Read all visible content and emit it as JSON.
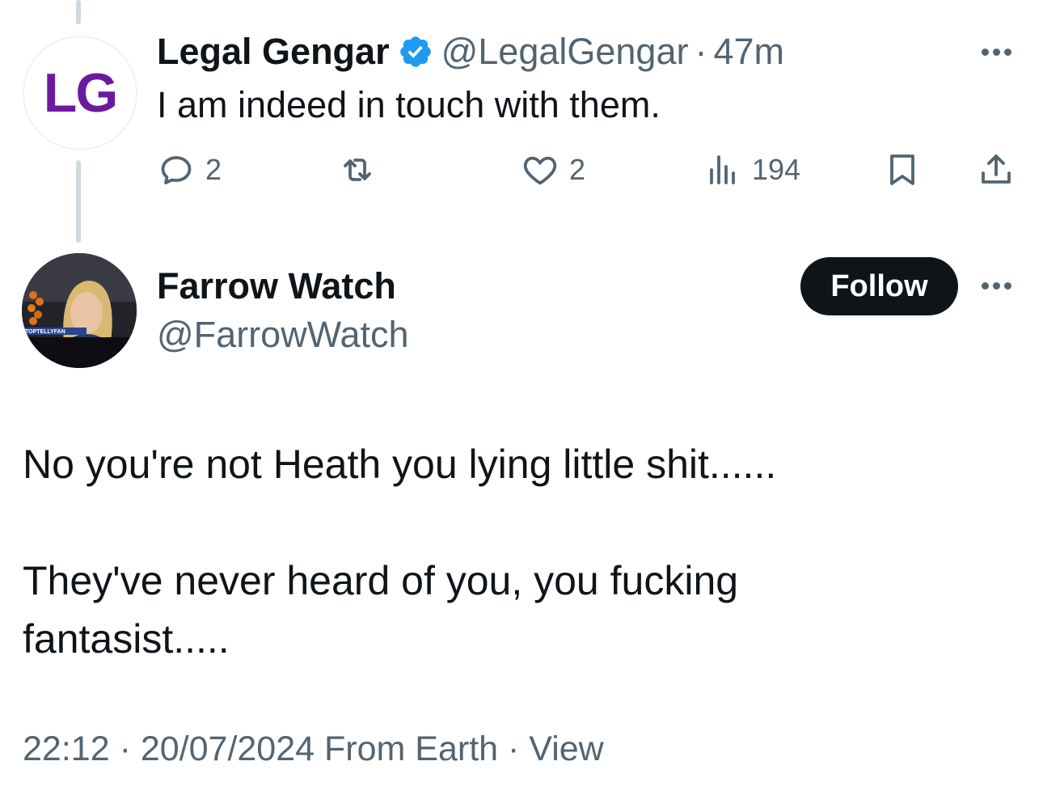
{
  "tweet1": {
    "avatar_text": "LG",
    "name": "Legal Gengar",
    "verified_icon": "verified-badge-icon",
    "handle": "@LegalGengar",
    "separator": "·",
    "time": "47m",
    "text": "I am indeed in touch with them.",
    "actions": {
      "reply_count": "2",
      "retweet_count": "",
      "like_count": "2",
      "views_count": "194"
    }
  },
  "tweet2": {
    "name": "Farrow Watch",
    "handle": "@FarrowWatch",
    "follow_label": "Follow",
    "avatar_caption": "TOPTELLYFAN",
    "paragraphs": [
      "No you're not Heath you lying little shit......",
      "They've never heard of you, you fucking fantasist....."
    ],
    "meta": {
      "time": "22:12",
      "date": "20/07/2024",
      "source": "From Earth",
      "view_label": "View",
      "separator": "·"
    }
  },
  "colors": {
    "text_primary": "#0f1419",
    "text_secondary": "#536471",
    "verified": "#1d9bf0",
    "thread_line": "#cfd9de",
    "follow_bg": "#0f1419",
    "logo_purple": "#6b1a9e"
  }
}
